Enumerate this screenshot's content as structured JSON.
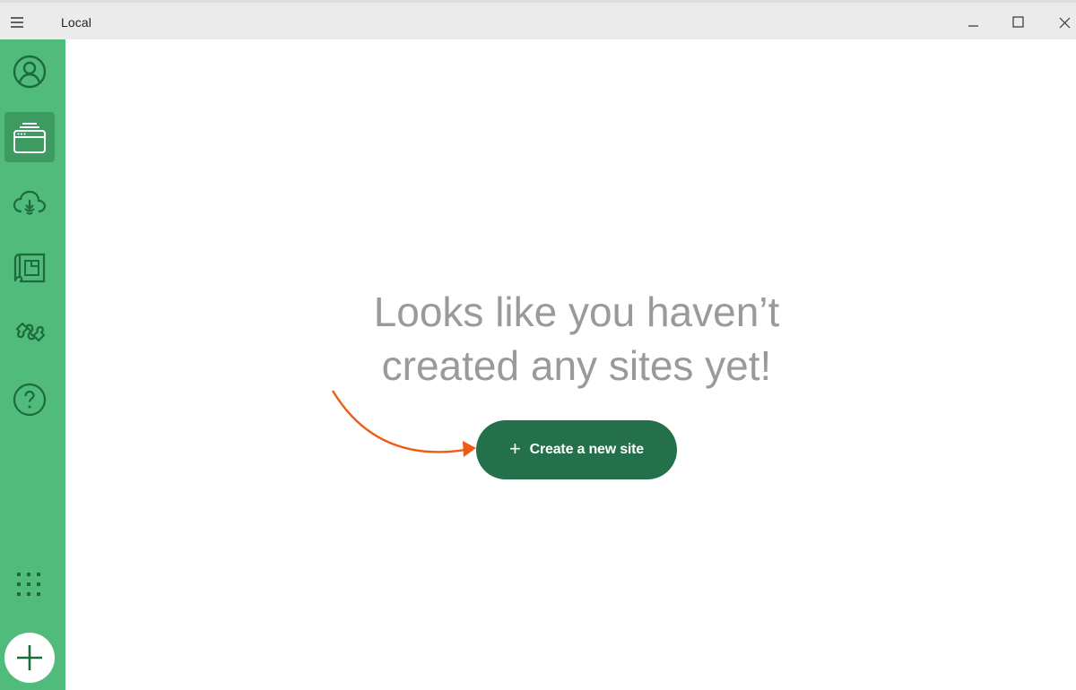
{
  "window": {
    "title": "Local",
    "controls": [
      "minimize-icon",
      "maximize-icon",
      "close-icon"
    ]
  },
  "sidebar": {
    "items": [
      {
        "icon": "user-icon"
      },
      {
        "icon": "sites-icon",
        "active": true
      },
      {
        "icon": "cloud-connect-icon"
      },
      {
        "icon": "blueprints-icon"
      },
      {
        "icon": "addons-puzzle-icon"
      },
      {
        "icon": "help-icon"
      }
    ],
    "bottom": [
      {
        "icon": "grid-dots-icon"
      },
      {
        "icon": "plus-icon"
      }
    ]
  },
  "main": {
    "empty_state": {
      "line1": "Looks like you haven’t",
      "line2": "created any sites yet!",
      "button_plus": "+",
      "button_label": "Create a new site"
    }
  },
  "colors": {
    "sidebar": "#51bb7b",
    "sidebar_active": "#3d9b62",
    "icon": "#1d6a3f",
    "button": "#23704a",
    "heading_text": "#9a9a9a",
    "annotation_arrow": "#f05a14"
  }
}
